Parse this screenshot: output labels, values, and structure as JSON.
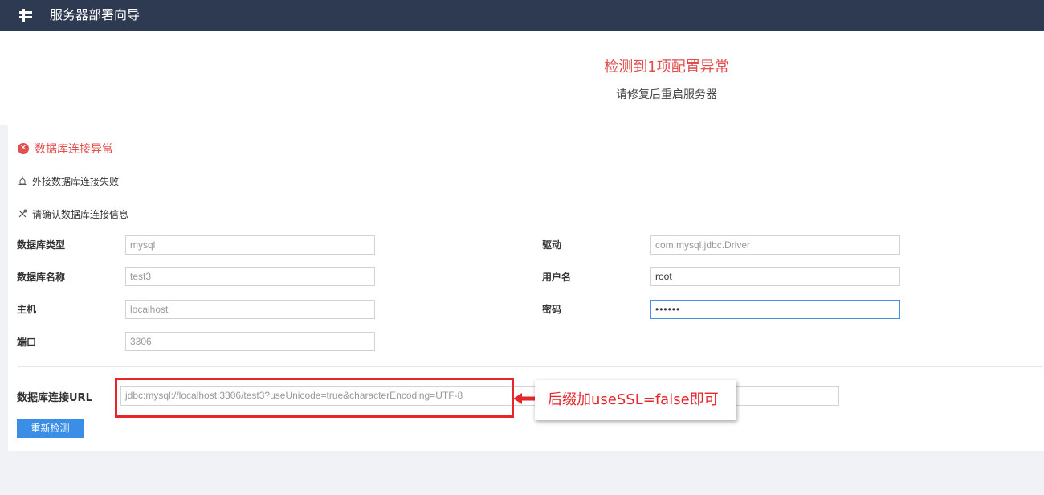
{
  "topbar": {
    "title": "服务器部署向导",
    "icon": "deploy-icon"
  },
  "status": {
    "headline": "检测到1项配置异常",
    "subline": "请修复后重启服务器"
  },
  "error": {
    "title": "数据库连接异常",
    "icon": "close-circle-icon",
    "color": "#e34f4f",
    "detail1": "外接数据库连接失败",
    "detail2": "请确认数据库连接信息"
  },
  "form": {
    "db_type_label": "数据库类型",
    "db_type_value": "mysql",
    "db_name_label": "数据库名称",
    "db_name_value": "test3",
    "host_label": "主机",
    "host_value": "localhost",
    "port_label": "端口",
    "port_value": "3306",
    "driver_label": "驱动",
    "driver_value": "com.mysql.jdbc.Driver",
    "username_label": "用户名",
    "username_value": "root",
    "password_label": "密码",
    "password_value": "••••••",
    "url_label": "数据库连接URL",
    "url_value": "jdbc:mysql://localhost:3306/test3?useUnicode=true&characterEncoding=UTF-8"
  },
  "actions": {
    "recheck_label": "重新检测",
    "button_color": "#3a8ee6"
  },
  "annotation": {
    "text": "后缀加useSSL=false即可",
    "color": "#e5262b"
  }
}
